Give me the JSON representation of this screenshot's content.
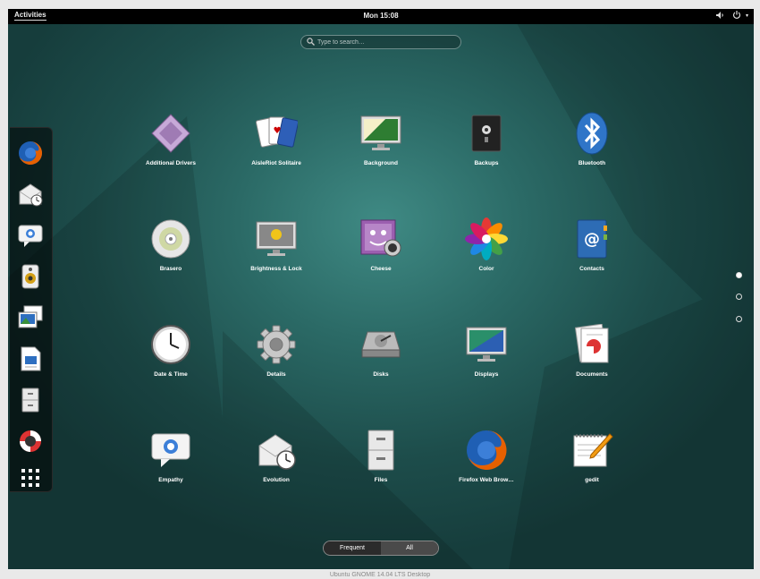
{
  "topbar": {
    "activities_label": "Activities",
    "clock": "Mon 15:08",
    "volume_icon": "volume-icon",
    "power_icon": "power-icon",
    "menu_arrow": "▾"
  },
  "search": {
    "placeholder": "Type to search…",
    "icon": "search-icon"
  },
  "dash": {
    "items": [
      {
        "name": "firefox",
        "icon": "firefox-icon"
      },
      {
        "name": "evolution",
        "icon": "mail-clock-icon"
      },
      {
        "name": "empathy",
        "icon": "chat-icon"
      },
      {
        "name": "rhythmbox",
        "icon": "speaker-icon"
      },
      {
        "name": "shotwell",
        "icon": "photos-icon"
      },
      {
        "name": "libreoffice-writer",
        "icon": "document-icon"
      },
      {
        "name": "files",
        "icon": "file-cabinet-icon"
      },
      {
        "name": "help",
        "icon": "lifebuoy-icon"
      },
      {
        "name": "show-applications",
        "icon": "grid-icon"
      }
    ]
  },
  "apps": [
    {
      "label": "Additional Drivers",
      "icon": "chip-icon"
    },
    {
      "label": "AisleRiot Solitaire",
      "icon": "cards-icon"
    },
    {
      "label": "Background",
      "icon": "monitor-wallpaper-icon"
    },
    {
      "label": "Backups",
      "icon": "safe-icon"
    },
    {
      "label": "Bluetooth",
      "icon": "bluetooth-icon"
    },
    {
      "label": "Brasero",
      "icon": "disc-icon"
    },
    {
      "label": "Brightness & Lock",
      "icon": "monitor-lock-icon"
    },
    {
      "label": "Cheese",
      "icon": "webcam-face-icon"
    },
    {
      "label": "Color",
      "icon": "color-flower-icon"
    },
    {
      "label": "Contacts",
      "icon": "address-book-icon"
    },
    {
      "label": "Date & Time",
      "icon": "clock-icon"
    },
    {
      "label": "Details",
      "icon": "gear-icon"
    },
    {
      "label": "Disks",
      "icon": "disk-drive-icon"
    },
    {
      "label": "Displays",
      "icon": "monitor-icon"
    },
    {
      "label": "Documents",
      "icon": "documents-icon"
    },
    {
      "label": "Empathy",
      "icon": "chat-icon"
    },
    {
      "label": "Evolution",
      "icon": "mail-clock-icon"
    },
    {
      "label": "Files",
      "icon": "file-cabinet-icon"
    },
    {
      "label": "Firefox Web Brow…",
      "icon": "firefox-icon"
    },
    {
      "label": "gedit",
      "icon": "notepad-pen-icon"
    }
  ],
  "pager": {
    "pages": 3,
    "current": 1
  },
  "view_switch": {
    "frequent_label": "Frequent",
    "all_label": "All",
    "selected": "Frequent"
  },
  "caption": "Ubuntu GNOME 14.04 LTS Desktop"
}
